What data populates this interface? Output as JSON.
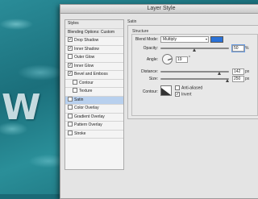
{
  "background": {
    "text": "W"
  },
  "dialog": {
    "title": "Layer Style"
  },
  "left_panel": {
    "items": [
      {
        "label": "Styles",
        "kind": "header"
      },
      {
        "label": "Blending Options: Custom",
        "kind": "header"
      },
      {
        "label": "Drop Shadow",
        "checked": true
      },
      {
        "label": "Inner Shadow",
        "checked": true
      },
      {
        "label": "Outer Glow",
        "checked": false
      },
      {
        "label": "Inner Glow",
        "checked": true
      },
      {
        "label": "Bevel and Emboss",
        "checked": true
      },
      {
        "label": "Contour",
        "checked": false,
        "indent": true
      },
      {
        "label": "Texture",
        "checked": false,
        "indent": true
      },
      {
        "label": "Satin",
        "checked": false,
        "selected": true
      },
      {
        "label": "Color Overlay",
        "checked": false
      },
      {
        "label": "Gradient Overlay",
        "checked": false
      },
      {
        "label": "Pattern Overlay",
        "checked": false
      },
      {
        "label": "Stroke",
        "checked": false
      }
    ]
  },
  "satin": {
    "section_title": "Satin",
    "structure_title": "Structure",
    "blend_mode_label": "Blend Mode:",
    "blend_mode_value": "Multiply",
    "blend_color": "#2a72d8",
    "opacity_label": "Opacity:",
    "opacity_value": "50",
    "opacity_unit": "%",
    "angle_label": "Angle:",
    "angle_value": "19",
    "angle_unit": "°",
    "distance_label": "Distance:",
    "distance_value": "142",
    "distance_unit": "px",
    "size_label": "Size:",
    "size_value": "250",
    "size_unit": "px",
    "contour_label": "Contour:",
    "anti_aliased_label": "Anti-aliased",
    "anti_aliased_checked": false,
    "invert_label": "Invert",
    "invert_checked": true
  }
}
